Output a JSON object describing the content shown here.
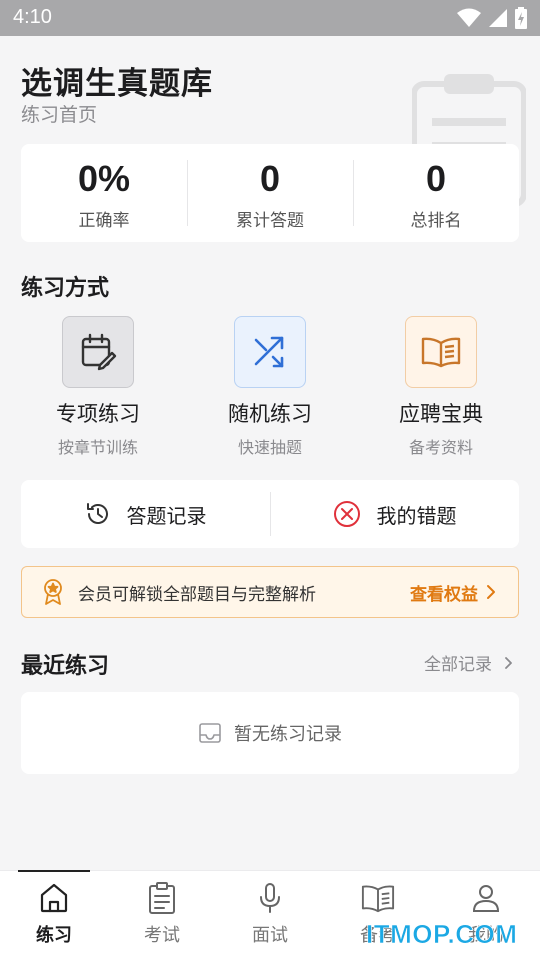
{
  "status_bar": {
    "time": "4:10"
  },
  "header": {
    "title": "选调生真题库",
    "subtitle": "练习首页"
  },
  "stats": [
    {
      "value": "0%",
      "label": "正确率"
    },
    {
      "value": "0",
      "label": "累计答题"
    },
    {
      "value": "0",
      "label": "总排名"
    }
  ],
  "practice": {
    "title": "练习方式",
    "modes": [
      {
        "name": "专项练习",
        "desc": "按章节训练",
        "icon": "calendar-edit-icon",
        "bg": "#e4e4e7",
        "border": "#c9c9cd",
        "color": "#333333"
      },
      {
        "name": "随机练习",
        "desc": "快速抽题",
        "icon": "shuffle-icon",
        "bg": "#eaf2fd",
        "border": "#b9d2f3",
        "color": "#2f6fd6"
      },
      {
        "name": "应聘宝典",
        "desc": "备考资料",
        "icon": "open-book-icon",
        "bg": "#fff4e8",
        "border": "#f2cda5",
        "color": "#c8762a"
      }
    ]
  },
  "records": {
    "history_label": "答题记录",
    "wrong_label": "我的错题"
  },
  "vip": {
    "text": "会员可解锁全部题目与完整解析",
    "link": "查看权益"
  },
  "recent": {
    "title": "最近练习",
    "all_label": "全部记录",
    "empty_text": "暂无练习记录"
  },
  "tabs": [
    {
      "label": "练习",
      "icon": "home-icon",
      "active": true
    },
    {
      "label": "考试",
      "icon": "exam-paper-icon",
      "active": false
    },
    {
      "label": "面试",
      "icon": "microphone-icon",
      "active": false
    },
    {
      "label": "备考",
      "icon": "book-icon",
      "active": false
    },
    {
      "label": "我的",
      "icon": "user-icon",
      "active": false
    }
  ],
  "watermark": "ITMOP.COM",
  "colors": {
    "accent_orange": "#e07a12",
    "shuffle_blue": "#2f6fd6",
    "wrong_red": "#e0313b",
    "vip_gold": "#e08a1e"
  }
}
